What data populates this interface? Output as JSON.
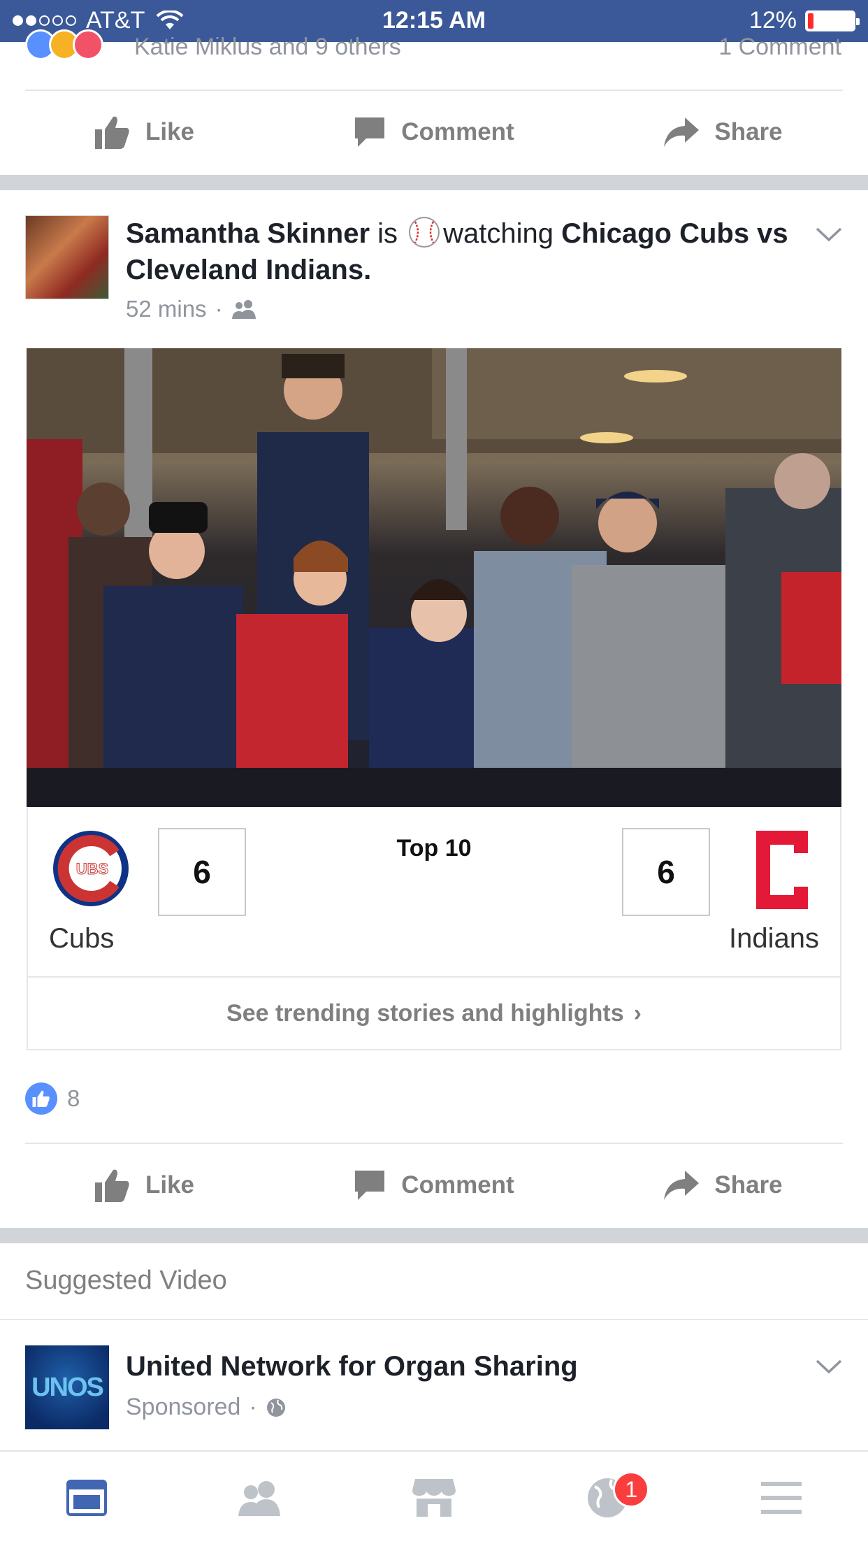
{
  "status_bar": {
    "carrier": "AT&T",
    "time": "12:15 AM",
    "battery": "12%",
    "battery_level": 0.12,
    "signal_bars": 2
  },
  "previous_post": {
    "reactions_text": "Katie Miklus and 9 others",
    "comments_text": "1 Comment",
    "actions": {
      "like": "Like",
      "comment": "Comment",
      "share": "Share"
    }
  },
  "post": {
    "author": "Samantha Skinner",
    "activity_verb": "is",
    "activity": "watching",
    "subject": "Chicago Cubs vs Cleveland Indians.",
    "time": "52 mins",
    "separator": "·",
    "audience_icon": "friends-icon",
    "photo_description_icon": "photo",
    "scoreboard": {
      "home_team": "Cubs",
      "home_score": "6",
      "away_team": "Indians",
      "away_score": "6",
      "inning": "Top 10",
      "cubs_logo_text": "UBS",
      "trending_link": "See trending stories and highlights",
      "trending_arrow": "›"
    },
    "likes_count": "8",
    "actions": {
      "like": "Like",
      "comment": "Comment",
      "share": "Share"
    }
  },
  "suggested": {
    "header": "Suggested Video",
    "sponsor_name": "United Network for Organ Sharing",
    "sponsor_logo_text": "UNOS",
    "sponsored_label": "Sponsored",
    "separator": "·",
    "audience_icon": "globe-icon"
  },
  "tab_bar": {
    "tabs": [
      "news-feed-icon",
      "friends-icon",
      "marketplace-icon",
      "notifications-icon",
      "menu-icon"
    ],
    "notifications_badge": "1",
    "active_color": "#4267b2",
    "inactive_color": "#bec2c9"
  },
  "colors": {
    "facebook_blue": "#3b5998",
    "like_blue": "#5890ff",
    "badge_red": "#fa3e3e",
    "cubs_blue": "#0e3386",
    "cubs_red": "#cc3433",
    "indians_red": "#e31937"
  }
}
